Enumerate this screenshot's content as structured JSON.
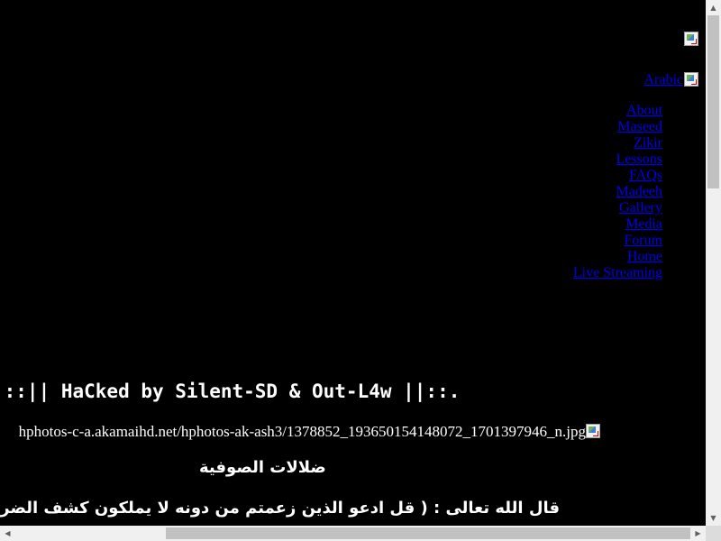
{
  "lang_link": {
    "label": "Arabic"
  },
  "nav": {
    "items": [
      {
        "label": "About"
      },
      {
        "label": "Maseed"
      },
      {
        "label": "Zikir"
      },
      {
        "label": "Lessons"
      },
      {
        "label": "FAQs"
      },
      {
        "label": "Madeeh"
      },
      {
        "label": "Gallery"
      },
      {
        "label": "Media"
      },
      {
        "label": "Forum"
      },
      {
        "label": "Home"
      },
      {
        "label": "Live Streaming"
      }
    ]
  },
  "content": {
    "hacked_text": ".::|| HaCked by Silent-SD & Out-L4w ||::.",
    "image_url_text": "hphotos-c-a.akamaihd.net/hphotos-ak-ash3/1378852_193650154148072_1701397946_n.jpg",
    "title_ar": "ضلالات الصوفية",
    "verse_ar": "قال الله تعالى : ( قل ادعو الذين زعمتم من دونه لا يملكون كشف الضر عنكم ولا تحويلا"
  },
  "scrollbar": {
    "up_arrow": "▲",
    "down_arrow": "▼",
    "left_arrow": "◀",
    "right_arrow": "▶"
  }
}
